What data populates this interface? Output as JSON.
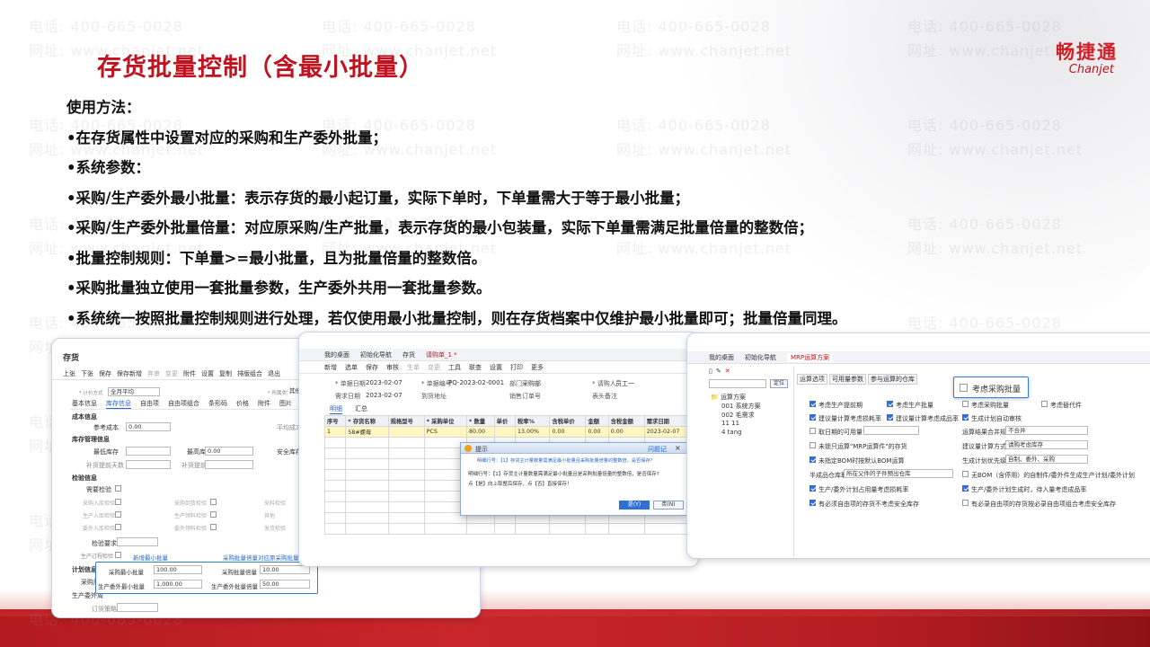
{
  "slide": {
    "title": "存货批量控制（含最小批量）",
    "logo": {
      "cn": "畅捷通",
      "en": "Chanjet"
    },
    "watermark": {
      "phone": "电话: 400-665-0028",
      "site": "网址: www.chanjet.net"
    },
    "lines": [
      "使用方法：",
      "•在存货属性中设置对应的采购和生产委外批量；",
      "•系统参数：",
      "•采购/生产委外最小批量：表示存货的最小起订量，实际下单时，下单量需大于等于最小批量；",
      "•采购/生产委外批量倍量：对应原采购/生产批量，表示存货的最小包装量，实际下单量需满足批量倍量的整数倍；",
      "•批量控制规则：下单量>=最小批量，且为批量倍量的整数倍。",
      "•采购批量独立使用一套批量参数，生产委外共用一套批量参数。",
      "•系统统一按照批量控制规则进行处理，若仅使用最小批量控制，则在存货档案中仅维护最小批量即可；批量倍量同理。"
    ]
  },
  "inventory_window": {
    "title": "存货",
    "toolbar": [
      "上张",
      "下张",
      "保存",
      "保存新增",
      "弃审",
      "变更",
      "附件",
      "设置",
      "复制",
      "排版组合",
      "退出"
    ],
    "pricing_label": "* 计价方式",
    "pricing_value": "全月平均",
    "owner_label": "* 所属类别",
    "owner_value": "其他",
    "tabs": [
      "基本信息",
      "库存信息",
      "自由项",
      "自由项组合",
      "条形码",
      "价格",
      "附件",
      "图片"
    ],
    "cost_section": "成本信息",
    "ref_cost_label": "参考成本",
    "ref_cost_value": "0.00",
    "avg_label": "平均成本",
    "stock_section": "库存管理信息",
    "min_stock_label": "最低库存",
    "max_stock_label": "最高库存",
    "safe_stock_label": "安全库存",
    "max_stock_value": "0.00",
    "days1_label": "补货提前天数",
    "days2_label": "补货提前天数",
    "inspect_section": "检验信息",
    "inspect_label": "需要检验",
    "inspect_rows": [
      [
        "采购入库检验",
        "采购到货检验",
        "采料检验"
      ],
      [
        "生产入库检验",
        "生产领料检验",
        "其他"
      ],
      [
        "委外入库检验",
        "委外领料检验",
        "发货检验"
      ]
    ],
    "inspect_req_label": "检验要求",
    "prod_label": "生产过程检验",
    "new_min_label": "新增最小批量",
    "mult_link": "采购批量倍量对应原采购批量",
    "plan_section": "计划信息",
    "purchase_label": "采购周",
    "prod_out_label": "生产委外周",
    "order_label": "订货策略",
    "callout": [
      {
        "label": "采购最小批量",
        "value": "100.00",
        "label2": "采购批量倍量",
        "value2": "10.00"
      },
      {
        "label": "生产委外最小批量",
        "value": "1,000.00",
        "label2": "生产委外批量倍量",
        "value2": "50.00"
      }
    ]
  },
  "order_window": {
    "tabs": [
      "我的桌面",
      "初始化导航",
      "存货",
      "请购单_1 *"
    ],
    "toolbar": [
      "新增",
      "选单",
      "保存",
      "审核",
      "生单",
      "变更",
      "工具",
      "联查",
      "设置",
      "打印",
      "更多"
    ],
    "header": [
      [
        "* 单据日期",
        "2023-02-07"
      ],
      [
        "* 单据编号",
        "PQ-2023-02-0001"
      ],
      [
        "部门",
        "采购部"
      ],
      [
        "* 请购人",
        "员工一"
      ]
    ],
    "header2": [
      [
        "需求日期",
        "2023-02-07"
      ],
      [
        "到货地址",
        ""
      ],
      [
        "销售订单号",
        ""
      ],
      [
        "表头备注",
        ""
      ]
    ],
    "subtabs": [
      "明细",
      "汇总"
    ],
    "columns": [
      "序号",
      "* 存货名称",
      "规格型号",
      "* 采购单位",
      "* 数量",
      "单价",
      "税率%",
      "含税单价",
      "金额",
      "含税金额",
      "需求日期"
    ],
    "rows": [
      [
        "1",
        "58#螺母",
        "",
        "PCS",
        "80.00",
        "",
        "13.00%",
        "0.00",
        "0.00",
        "0.00",
        "2023-02-07"
      ]
    ],
    "dialog": {
      "title": "提示",
      "help": "问题记",
      "msg1": "明细行号：【1】存货主计量数量需满足最小批量且采购批量倍量的整数倍，是否保存？",
      "msg2": "明细行号：【1】存货主计量数量需满足最小批量且是采购批量倍量的整数倍，是否保存?",
      "msg3": "点【是】向上取整后保存，点【否】直接保存！",
      "yes": "是(Y)",
      "no": "否(N)"
    }
  },
  "mrp_window": {
    "tabs": [
      "我的桌面",
      "初始化导航",
      "MRP运算方案"
    ],
    "tree_root": "运算方案",
    "tree_items": [
      "001 系统方案",
      "002 毛需求",
      "11 11",
      "4 tang"
    ],
    "locate_btn": "定位",
    "subtabs": [
      "运算选项",
      "可用量参数",
      "参与运算的仓库"
    ],
    "callout_label": "考虑采购批量",
    "options": [
      {
        "c1": "考虑生产提前期",
        "c1on": true,
        "c2": "考虑生产批量",
        "c2on": true,
        "c3": "考虑采购批量",
        "c3on": false,
        "c4": "考虑替代件",
        "c4on": false
      },
      {
        "c1": "建议量计算考虑损耗率",
        "c1on": true,
        "c2": "建议量计算考虑成品率",
        "c2on": true,
        "c3": "生成计划自动审核",
        "c3on": true
      }
    ],
    "row3_label": "取日期的可用量",
    "row3_right_label": "运算结果合并规则",
    "row3_right_value": "不合并",
    "row4_label": "未锁只运算\"MRP运算件\"的存货",
    "row4_right_label": "建议量计算方式",
    "row4_right_value": "请购考虑库存",
    "row5_label": "未指定BOM时按默认BOM运算",
    "row5_right_label": "生成计划优先级",
    "row5_right_value": "自制、委外、采购",
    "row6_label": "半成品仓库取值",
    "row6_value": "所在父件的子件预出仓库",
    "row6_right": "无BOM（含停用）的自制件/委外件生成生产计划/委外计划",
    "row7_label": "生产/委外计划占用量考虑损耗率",
    "row7_right": "生产/委外计划生成时，待入量考虑成品率",
    "row8_label": "有必须自由项的存货不考虑安全库存",
    "row8_right": "有必录自由项的存货按必录自由项组合考虑安全库存"
  }
}
